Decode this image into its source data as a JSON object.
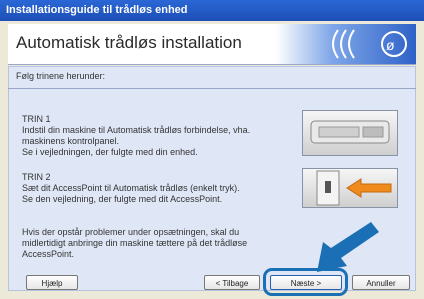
{
  "window": {
    "title": "Installationsguide til trådløs enhed"
  },
  "header": {
    "title": "Automatisk trådløs installation"
  },
  "main": {
    "instruction": "Følg trinene herunder:",
    "steps": [
      {
        "heading": "TRIN 1",
        "lines": [
          "Indstil din maskine til Automatisk trådløs forbindelse, vha.",
          "maskinens kontrolpanel.",
          "Se i vejledningen, der fulgte med din enhed."
        ]
      },
      {
        "heading": "TRIN 2",
        "lines": [
          "Sæt dit AccessPoint til Automatisk trådløs (enkelt tryk).",
          "Se den vejledning, der fulgte med dit AccessPoint."
        ]
      }
    ],
    "note_lines": [
      "Hvis der opstår problemer under opsætningen, skal du",
      "midlertidigt anbringe din maskine tættere på det trådløse",
      "AccessPoint."
    ]
  },
  "footer": {
    "help_label": "Hjælp",
    "back_label": "< Tilbage",
    "next_label": "Næste >",
    "cancel_label": "Annuller"
  },
  "icons": {
    "brand": "wireless-brand-icon",
    "printer": "printer-panel-image",
    "access_point": "access-point-image",
    "arrow_orange": "orange-arrow-icon",
    "arrow_blue": "blue-pointer-arrow-icon"
  },
  "colors": {
    "titlebar": "#2b67d6",
    "panel": "#dfe7f6",
    "highlight_ring": "#1b6fb4",
    "arrow_orange": "#f08a1c"
  }
}
